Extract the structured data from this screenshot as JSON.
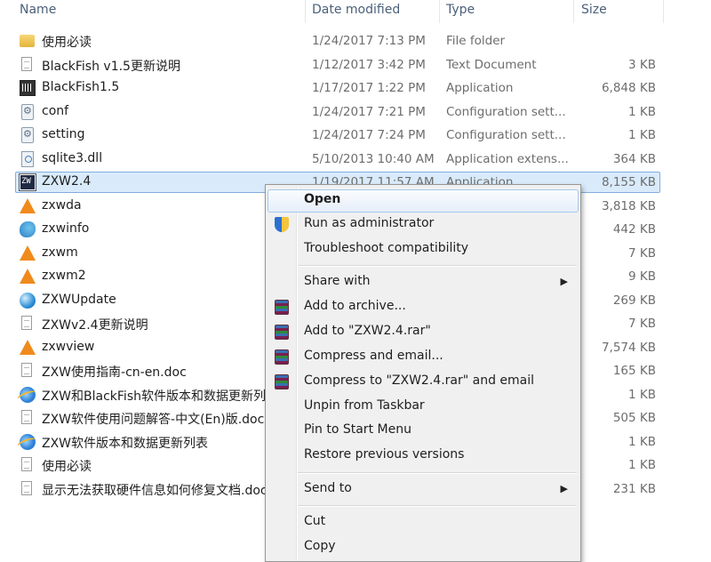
{
  "columns": {
    "name": "Name",
    "date": "Date modified",
    "type": "Type",
    "size": "Size"
  },
  "files": [
    {
      "icon": "folder-icon",
      "name": "使用必读",
      "date": "1/24/2017 7:13 PM",
      "type": "File folder",
      "size": ""
    },
    {
      "icon": "text-document-icon",
      "name": "BlackFish v1.5更新说明",
      "date": "1/12/2017 3:42 PM",
      "type": "Text Document",
      "size": "3 KB"
    },
    {
      "icon": "application-icon",
      "name": "BlackFish1.5",
      "date": "1/17/2017 1:22 PM",
      "type": "Application",
      "size": "6,848 KB"
    },
    {
      "icon": "config-file-icon",
      "name": "conf",
      "date": "1/24/2017 7:21 PM",
      "type": "Configuration sett...",
      "size": "1 KB"
    },
    {
      "icon": "config-file-icon",
      "name": "setting",
      "date": "1/24/2017 7:24 PM",
      "type": "Configuration sett...",
      "size": "1 KB"
    },
    {
      "icon": "dll-file-icon",
      "name": "sqlite3.dll",
      "date": "5/10/2013 10:40 AM",
      "type": "Application extens...",
      "size": "364 KB"
    },
    {
      "icon": "zxw-app-icon",
      "name": "ZXW2.4",
      "date": "1/19/2017 11:57 AM",
      "type": "Application",
      "size": "8,155 KB"
    },
    {
      "icon": "vlc-file-icon",
      "name": "zxwda",
      "date": "",
      "type": "",
      "size": "3,818 KB"
    },
    {
      "icon": "bird-app-icon",
      "name": "zxwinfo",
      "date": "",
      "type": "",
      "size": "442 KB"
    },
    {
      "icon": "vlc-file-icon",
      "name": "zxwm",
      "date": "",
      "type": "",
      "size": "7 KB"
    },
    {
      "icon": "vlc-file-icon",
      "name": "zxwm2",
      "date": "",
      "type": "",
      "size": "9 KB"
    },
    {
      "icon": "update-app-icon",
      "name": "ZXWUpdate",
      "date": "",
      "type": "",
      "size": "269 KB"
    },
    {
      "icon": "text-document-icon",
      "name": "ZXWv2.4更新说明",
      "date": "",
      "type": "",
      "size": "7 KB"
    },
    {
      "icon": "vlc-file-icon",
      "name": "zxwview",
      "date": "",
      "type": "",
      "size": "7,574 KB"
    },
    {
      "icon": "word-document-icon",
      "name": "ZXW使用指南-cn-en.doc",
      "date": "",
      "type": "",
      "size": "165 KB"
    },
    {
      "icon": "internet-shortcut-icon",
      "name": "ZXW和BlackFish软件版本和数据更新列表",
      "date": "",
      "type": "",
      "size": "1 KB"
    },
    {
      "icon": "word-document-icon",
      "name": "ZXW软件使用问题解答-中文(En)版.doc",
      "date": "",
      "type": "",
      "size": "505 KB"
    },
    {
      "icon": "internet-shortcut-icon",
      "name": "ZXW软件版本和数据更新列表",
      "date": "",
      "type": "",
      "size": "1 KB"
    },
    {
      "icon": "text-document-icon",
      "name": "使用必读",
      "date": "",
      "type": "",
      "size": "1 KB"
    },
    {
      "icon": "word-document-icon",
      "name": "显示无法获取硬件信息如何修复文档.doc",
      "date": "",
      "type": "",
      "size": "231 KB"
    }
  ],
  "context_menu": {
    "open": "Open",
    "run_as_admin": "Run as administrator",
    "troubleshoot": "Troubleshoot compatibility",
    "share_with": "Share with",
    "add_to_archive": "Add to archive...",
    "add_to_rar": "Add to \"ZXW2.4.rar\"",
    "compress_email": "Compress and email...",
    "compress_rar_email": "Compress to \"ZXW2.4.rar\" and email",
    "unpin_taskbar": "Unpin from Taskbar",
    "pin_start": "Pin to Start Menu",
    "restore_versions": "Restore previous versions",
    "send_to": "Send to",
    "cut": "Cut",
    "copy": "Copy",
    "submenu_arrow": "▶"
  }
}
